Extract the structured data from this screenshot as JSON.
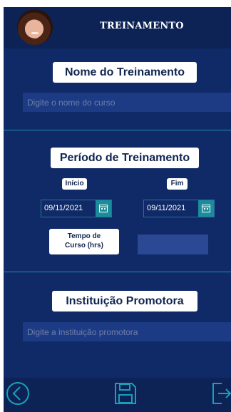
{
  "header": {
    "title": "TREINAMENTO"
  },
  "sections": {
    "nome": {
      "label": "Nome do Treinamento",
      "placeholder": "Digite o nome do curso"
    },
    "periodo": {
      "label": "Período de Treinamento",
      "inicio": {
        "label": "Início",
        "value": "09/11/2021"
      },
      "fim": {
        "label": "Fim",
        "value": "09/11/2021"
      },
      "tempo": {
        "label_line1": "Tempo de",
        "label_line2": "Curso (hrs)",
        "value": ""
      }
    },
    "instituicao": {
      "label": "Instituição Promotora",
      "placeholder": "Digite a instituição promotora"
    }
  },
  "footer": {
    "icons": [
      "back-icon",
      "save-icon",
      "logout-icon"
    ]
  },
  "colors": {
    "background": "#102a67",
    "header": "#0d2355",
    "accent": "#1a8c9a",
    "divider": "#1f8fb1"
  }
}
